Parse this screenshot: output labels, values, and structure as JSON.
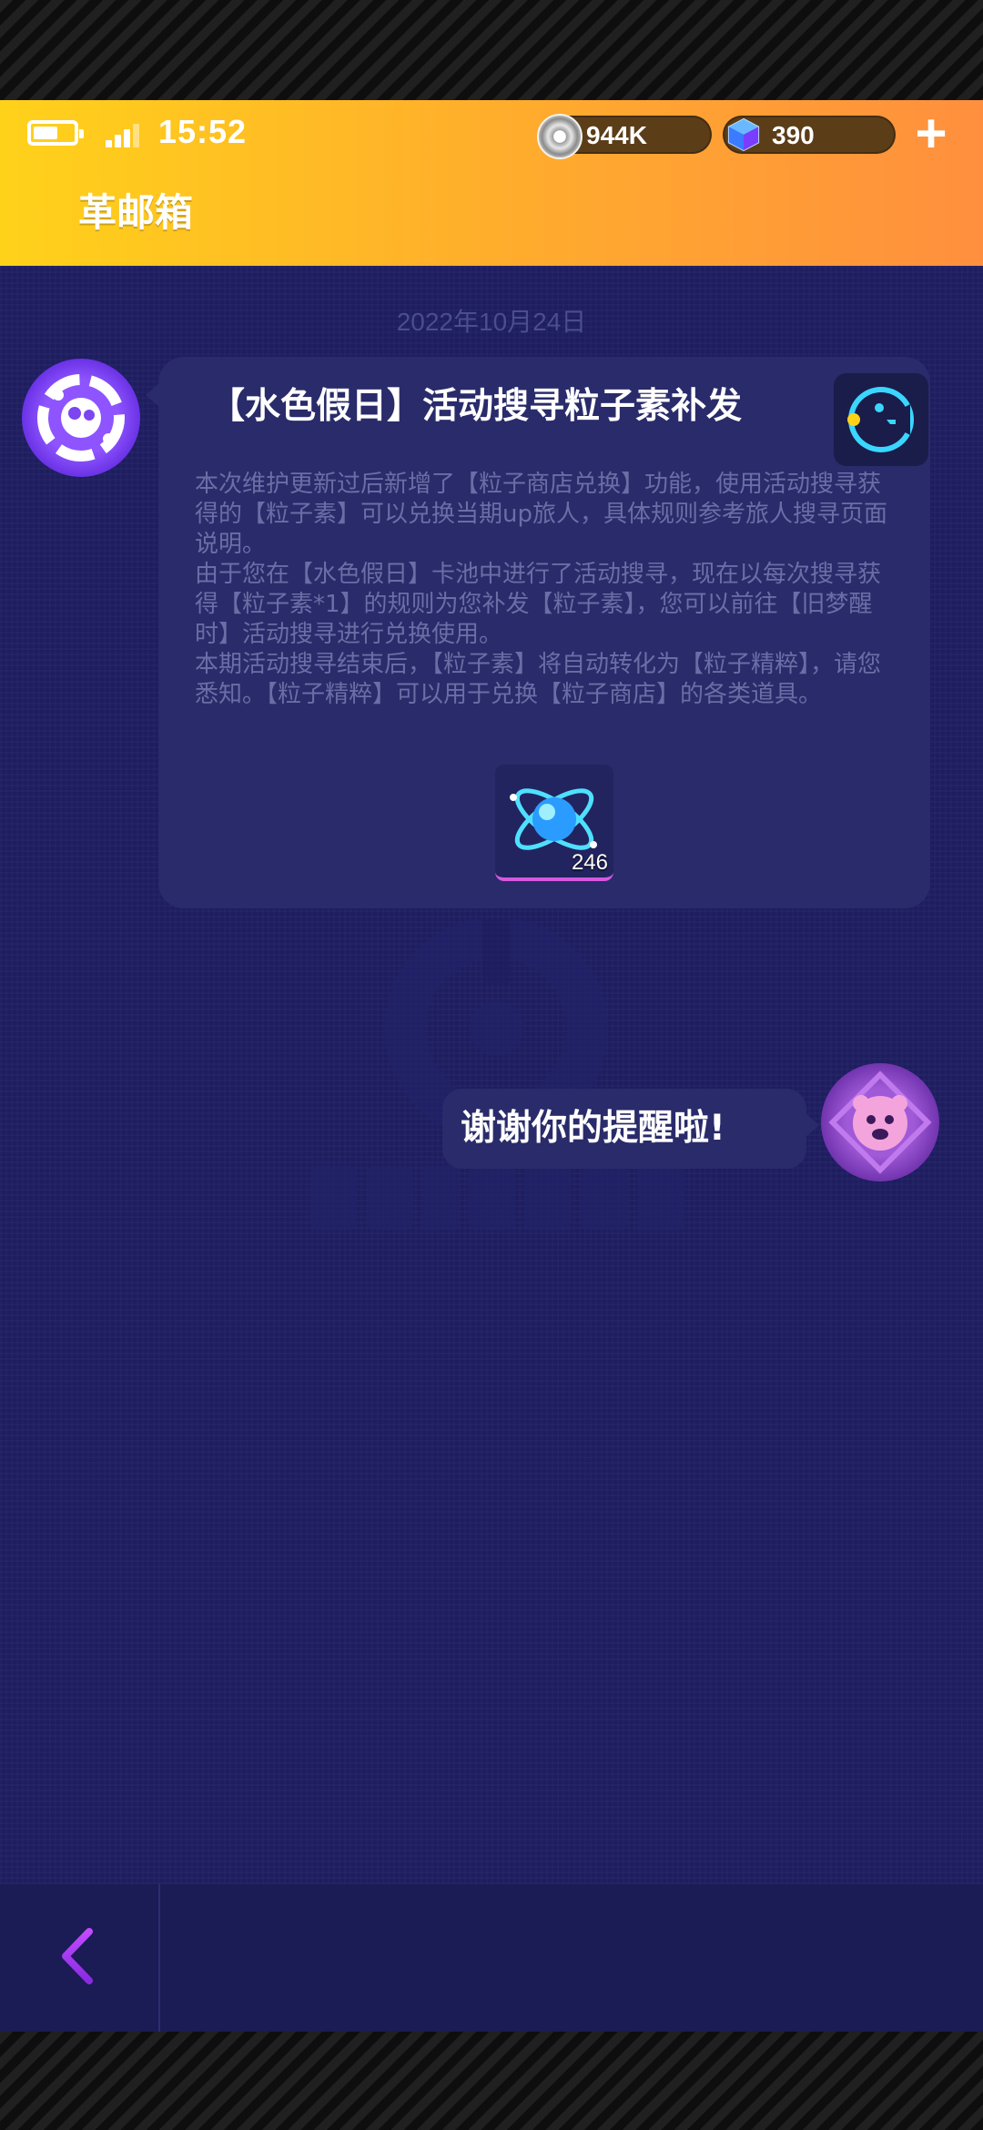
{
  "status_bar": {
    "time": "15:52",
    "battery_icon": "battery-icon",
    "signal_icon": "signal-icon"
  },
  "header": {
    "title": "革邮箱",
    "currency": [
      {
        "icon": "coin-icon",
        "value": "944K"
      },
      {
        "icon": "cube-gem-icon",
        "value": "390"
      }
    ],
    "add_icon": "plus-icon"
  },
  "conversation": {
    "date": "2022年10月24日",
    "message": {
      "title": "【水色假日】活动搜寻粒子素补发",
      "body": "本次维护更新过后新增了【粒子商店兑换】功能，使用活动搜寻获得的【粒子素】可以兑换当期up旅人，具体规则参考旅人搜寻页面说明。\n由于您在【水色假日】卡池中进行了活动搜寻，现在以每次搜寻获得【粒子素*1】的规则为您补发【粒子素】，您可以前往【旧梦醒时】活动搜寻进行兑换使用。\n本期活动搜寻结束后，【粒子素】将自动转化为【粒子精粹】，请您悉知。【粒子精粹】可以用于兑换【粒子商店】的各类道具。",
      "attachment": {
        "icon": "particle-atom-icon",
        "count": "246"
      }
    },
    "reply": {
      "text": "谢谢你的提醒啦!"
    }
  },
  "watermark_icon": "colorful-logo-icon",
  "footer": {
    "back_icon": "chevron-left-icon"
  },
  "colors": {
    "header_gradient_start": "#ffd21a",
    "header_gradient_end": "#ff8f3e",
    "background": "#1d1d60",
    "bubble": "#292b6a",
    "accent_pink": "#d658e0"
  }
}
